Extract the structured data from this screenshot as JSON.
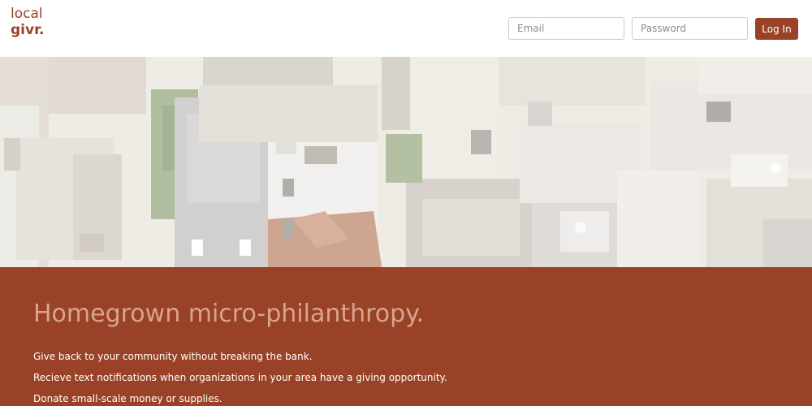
{
  "brand": {
    "line1": "local",
    "line2": "givr.",
    "accent": "#9a4227"
  },
  "login": {
    "email_placeholder": "Email",
    "password_placeholder": "Password",
    "submit_label": "Log In"
  },
  "hero": {
    "image_subject": "aerial view of city rooftops"
  },
  "pitch": {
    "headline": "Homegrown micro-philanthropy.",
    "points": [
      "Give back to your community without breaking the bank.",
      "Recieve text notifications when organizations in your area have a giving opportunity.",
      "Donate small-scale money or supplies."
    ]
  }
}
